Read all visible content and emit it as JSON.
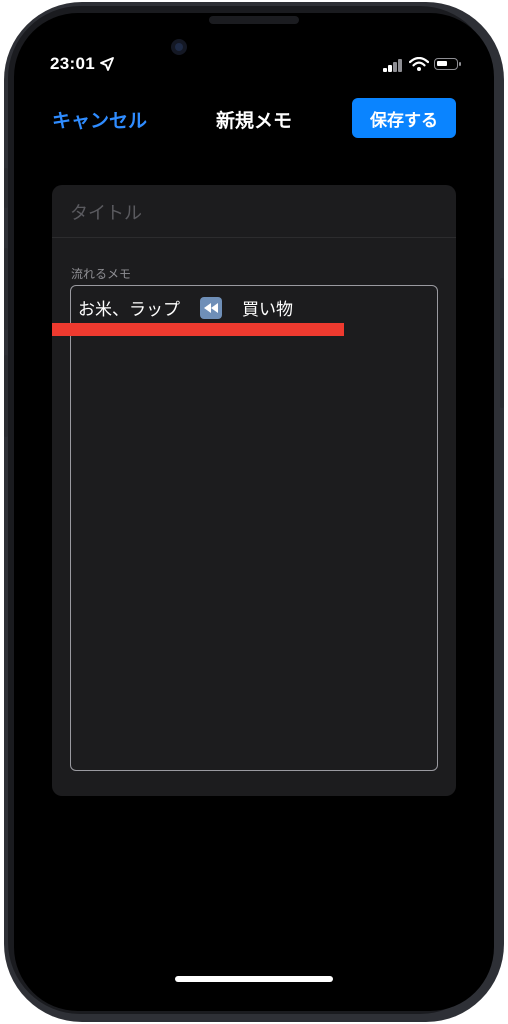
{
  "status_bar": {
    "time": "23:01",
    "icons": [
      "location-arrow-icon",
      "signal-bars-icon",
      "wifi-icon",
      "battery-icon"
    ]
  },
  "nav": {
    "cancel_label": "キャンセル",
    "title": "新規メモ",
    "save_label": "保存する"
  },
  "form": {
    "title_placeholder": "タイトル",
    "title_value": "",
    "memo_label": "流れるメモ",
    "memo_text_before": "お米、ラップ",
    "memo_icon": "rewind-icon",
    "memo_text_after": "買い物"
  },
  "colors": {
    "accent": "#0a84ff",
    "cancel_text": "#2f8cff",
    "highlight_bar": "#ee3a2f",
    "background": "#000000",
    "card": "#1c1c1e"
  }
}
